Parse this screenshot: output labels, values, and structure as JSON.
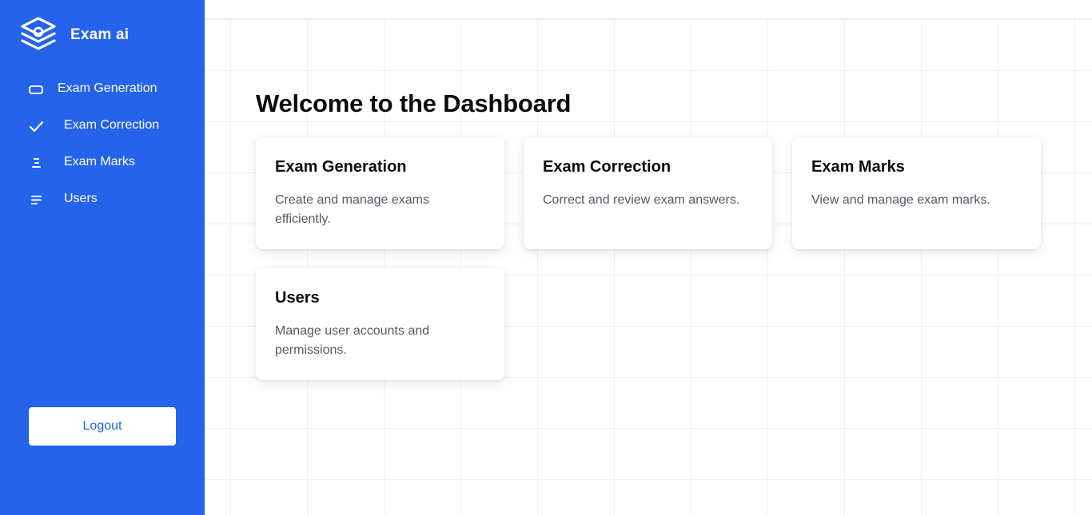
{
  "app": {
    "name": "Exam ai"
  },
  "sidebar": {
    "items": [
      {
        "label": "Exam Generation",
        "icon": "rectangle-icon"
      },
      {
        "label": "Exam Correction",
        "icon": "check-icon"
      },
      {
        "label": "Exam Marks",
        "icon": "list-indent-icon"
      },
      {
        "label": "Users",
        "icon": "menu-lines-icon"
      }
    ],
    "logout_label": "Logout"
  },
  "main": {
    "title": "Welcome to the Dashboard",
    "cards": [
      {
        "title": "Exam Generation",
        "description": "Create and manage exams efficiently."
      },
      {
        "title": "Exam Correction",
        "description": "Correct and review exam answers."
      },
      {
        "title": "Exam Marks",
        "description": "View and manage exam marks."
      },
      {
        "title": "Users",
        "description": "Manage user accounts and permissions."
      }
    ]
  },
  "colors": {
    "primary": "#2563eb",
    "background": "#ffffff",
    "grid_line": "#eef0f3",
    "text_dark": "#0b0b0f",
    "text_muted": "#555a64"
  }
}
